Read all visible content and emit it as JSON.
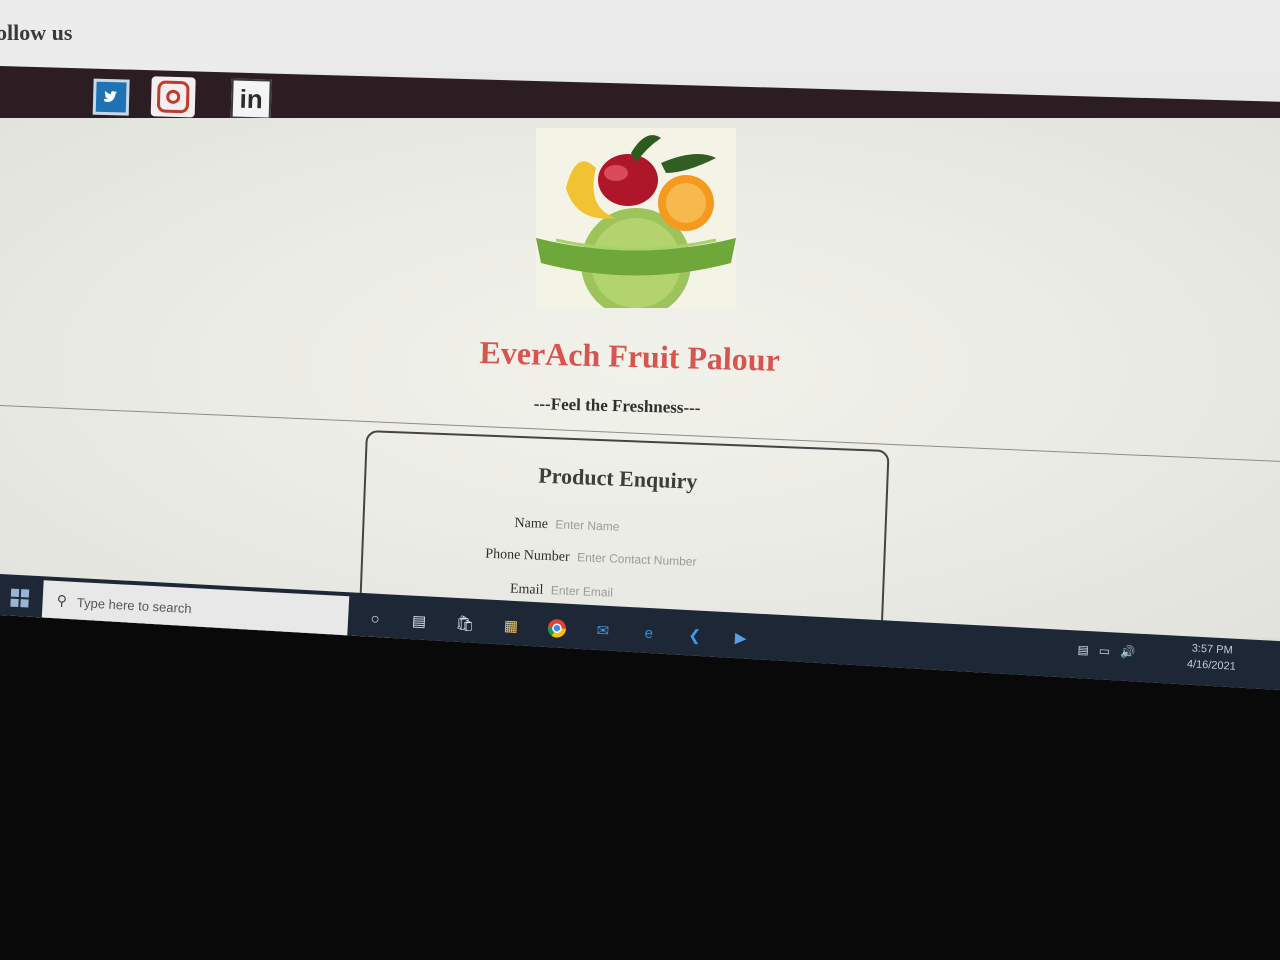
{
  "header": {
    "follow_text": "ollow us"
  },
  "social": {
    "twitter_icon": "twitter-icon",
    "instagram_icon": "instagram-icon",
    "linkedin_label": "in"
  },
  "site": {
    "title": "EverAch Fruit Palour",
    "tagline": "---Feel the Freshness---"
  },
  "form": {
    "title": "Product Enquiry",
    "fields": [
      {
        "label": "Name",
        "placeholder": "Enter Name"
      },
      {
        "label": "Phone Number",
        "placeholder": "Enter Contact Number"
      },
      {
        "label": "Email",
        "placeholder": "Enter Email"
      }
    ]
  },
  "taskbar": {
    "search_placeholder": "Type here to search",
    "time": "3:57 PM",
    "date": "4/16/2021",
    "apps": [
      "cortana-icon",
      "task-view-icon",
      "store-icon",
      "file-explorer-icon",
      "chrome-icon",
      "mail-icon",
      "edge-icon",
      "vscode-icon",
      "media-icon"
    ]
  },
  "colors": {
    "title": "#d9534f",
    "social_bar": "#2c1d22",
    "taskbar": "#1e2736"
  }
}
